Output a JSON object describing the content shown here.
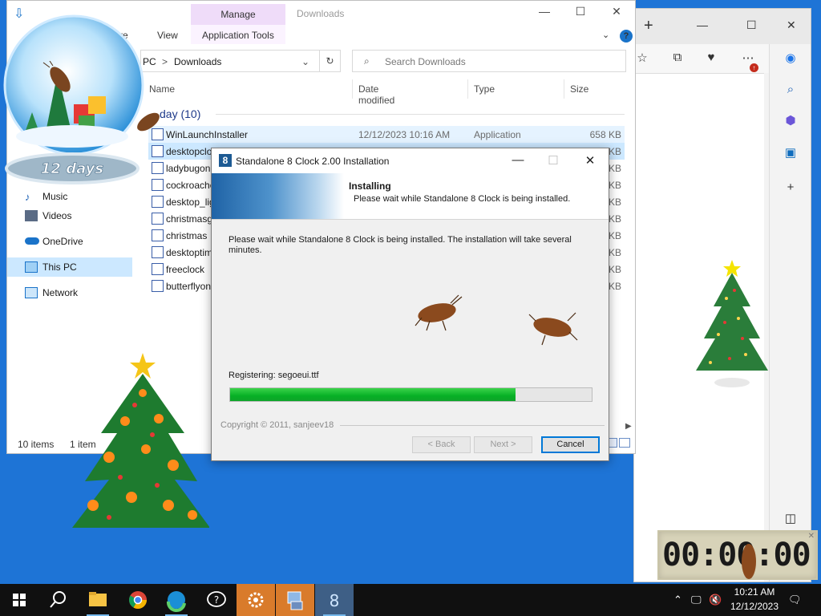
{
  "edge": {
    "icons": [
      "favorites-star-icon",
      "collections-icon",
      "performance-icon",
      "more-icon",
      "copilot-icon",
      "search-icon",
      "copilot-shield-icon",
      "outlook-icon",
      "add-icon",
      "split-view-icon"
    ]
  },
  "explorer": {
    "ribbon_tab_manage": "Manage",
    "title": "Downloads",
    "tabs": {
      "share": "re",
      "view": "View",
      "app_tools": "Application Tools"
    },
    "address": {
      "prefix": "PC",
      "separator": ">",
      "location": "Downloads"
    },
    "search_placeholder": "Search Downloads",
    "columns": {
      "name": "Name",
      "date": "Date modified",
      "type": "Type",
      "size": "Size"
    },
    "group_label": "day (10)",
    "nav": [
      {
        "label": "Music",
        "icon": "music-icon"
      },
      {
        "label": "Videos",
        "icon": "videos-icon"
      },
      {
        "label": "OneDrive",
        "icon": "onedrive-icon"
      },
      {
        "label": "This PC",
        "icon": "this-pc-icon"
      },
      {
        "label": "Network",
        "icon": "network-icon"
      }
    ],
    "files": [
      {
        "name": "WinLaunchInstaller",
        "date": "12/12/2023 10:16 AM",
        "type": "Application",
        "size": "658 KB"
      },
      {
        "name": "desktopclo",
        "date": "",
        "type": "",
        "size": "KB"
      },
      {
        "name": "ladybugon",
        "date": "",
        "type": "",
        "size": "KB"
      },
      {
        "name": "cockroache",
        "date": "",
        "type": "",
        "size": "KB"
      },
      {
        "name": "desktop_lig",
        "date": "",
        "type": "",
        "size": "KB"
      },
      {
        "name": "christmasg",
        "date": "",
        "type": "",
        "size": "KB"
      },
      {
        "name": "christmas",
        "date": "",
        "type": "",
        "size": "KB"
      },
      {
        "name": "desktoptim",
        "date": "",
        "type": "",
        "size": "KB"
      },
      {
        "name": "freeclock",
        "date": "",
        "type": "",
        "size": "KB"
      },
      {
        "name": "butterflyon",
        "date": "",
        "type": "",
        "size": "KB"
      }
    ],
    "status_items": "10 items",
    "status_selected": "1 item"
  },
  "installer": {
    "title": "Standalone 8 Clock 2.00 Installation",
    "app_icon_glyph": "8",
    "header_title": "Installing",
    "header_sub": "Please wait while Standalone 8 Clock is being installed.",
    "message": "Please wait while Standalone 8 Clock is being installed. The installation will take several minutes.",
    "registering": "Registering: segoeui.ttf",
    "progress": 0.79,
    "copyright": "Copyright © 2011, sanjeev18",
    "back": "< Back",
    "next": "Next >",
    "cancel": "Cancel"
  },
  "decor": {
    "snowglobe_text": "12 days"
  },
  "clock_widget": {
    "display": "00:00:00"
  },
  "taskbar": {
    "time": "10:21 AM",
    "date": "12/12/2023",
    "items": [
      "start-icon",
      "search-icon",
      "file-explorer-icon",
      "chrome-icon",
      "edge-icon",
      "help-icon",
      "settings-icon",
      "installer-icon",
      "standalone-8-clock-icon"
    ]
  },
  "colors": {
    "accent": "#0078d7",
    "progress": "#06b025",
    "desktop": "#1e74d6"
  }
}
